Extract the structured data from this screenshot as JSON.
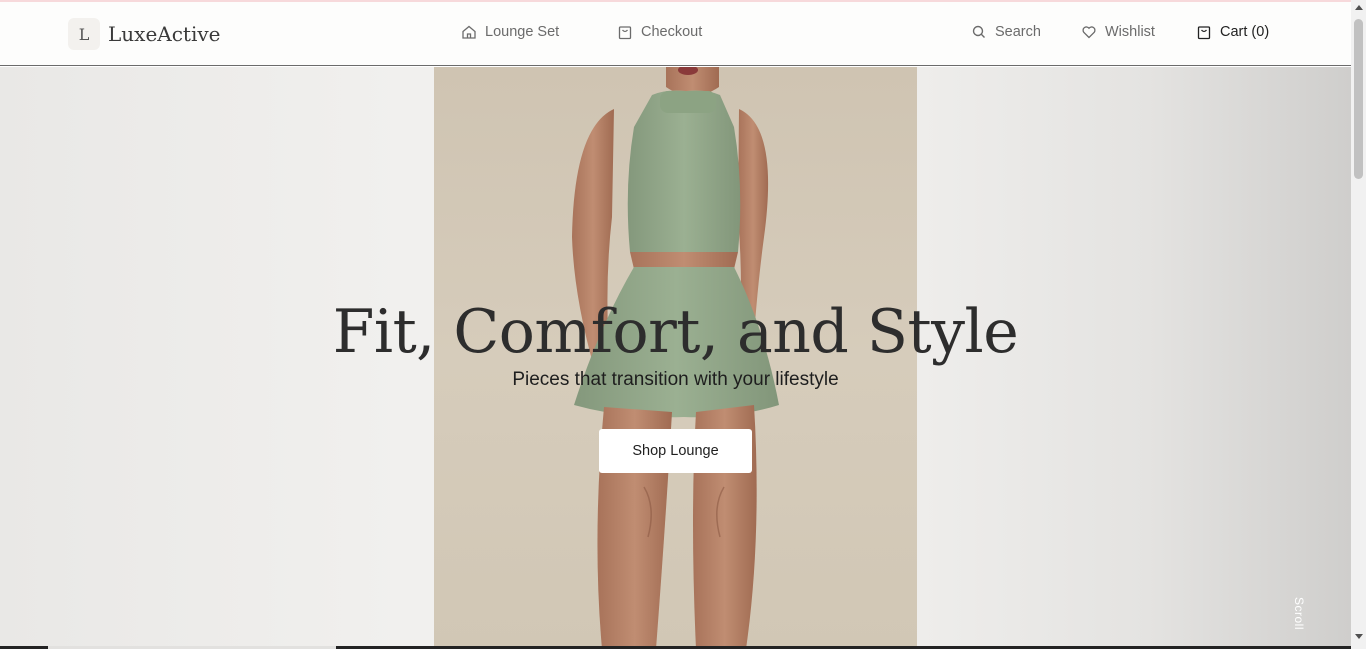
{
  "brand": {
    "badge": "L",
    "name": "LuxeActive"
  },
  "nav": {
    "lounge_set": "Lounge Set",
    "checkout": "Checkout",
    "search": "Search",
    "wishlist": "Wishlist",
    "cart": "Cart (0)"
  },
  "hero": {
    "headline": "Fit, Comfort, and Style",
    "subline": "Pieces that transition with your lifestyle",
    "cta": "Shop Lounge",
    "scroll": "Scroll"
  },
  "colors": {
    "accent_top_line": "#f7d9db",
    "top_color": "#93a68a",
    "backdrop": "#d3c9b8"
  },
  "icons": [
    "home-icon",
    "bag-icon",
    "search-icon",
    "heart-icon",
    "cart-icon"
  ]
}
